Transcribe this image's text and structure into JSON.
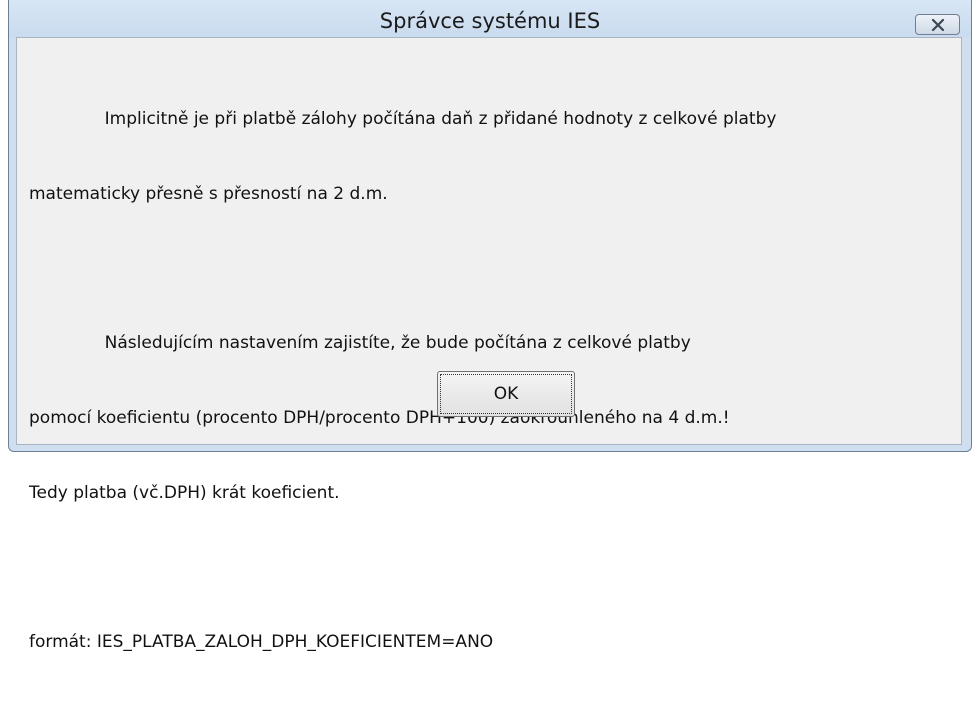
{
  "window": {
    "title": "Správce systému IES"
  },
  "icons": {
    "close": "close-icon"
  },
  "message": {
    "para1_line1": "              Implicitně je při platbě zálohy počítána daň z přidané hodnoty z celkové platby",
    "para1_line2": "matematicky přesně s přesností na 2 d.m.",
    "para2_line1": "              Následujícím nastavením zajistíte, že bude počítána z celkové platby",
    "para2_line2": "pomocí koeficientu (procento DPH/procento DPH+100) zaokrouhleného na 4 d.m.!",
    "para2_line3": "Tedy platba (vč.DPH) krát koeficient.",
    "format_line": "formát: IES_PLATBA_ZALOH_DPH_KOEFICIENTEM=ANO"
  },
  "buttons": {
    "ok_label": "OK"
  }
}
